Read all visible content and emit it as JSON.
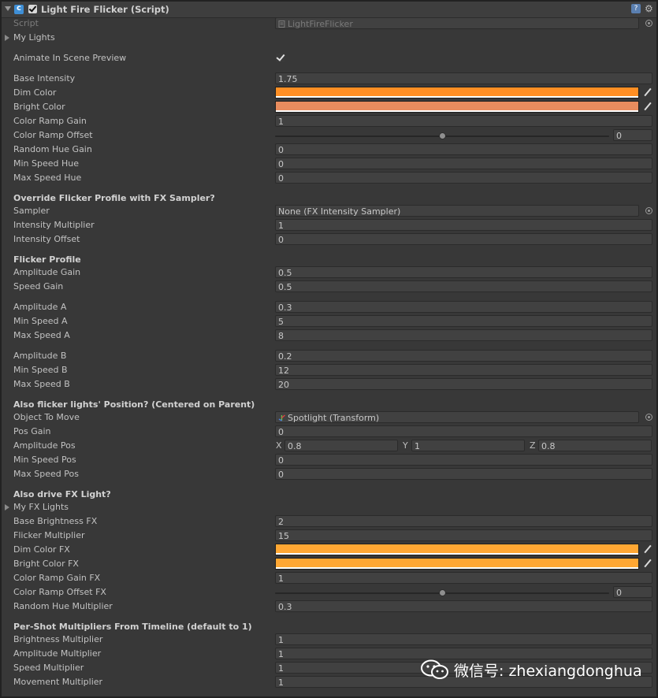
{
  "header": {
    "title": "Light Fire Flicker (Script)",
    "enabled": true
  },
  "script_field": {
    "label": "Script",
    "value": "LightFireFlicker"
  },
  "my_lights": {
    "label": "My Lights"
  },
  "animate_preview": {
    "label": "Animate In Scene Preview",
    "checked": true
  },
  "base": [
    {
      "label": "Base Intensity",
      "value": "1.75"
    }
  ],
  "colors": {
    "dim": {
      "label": "Dim Color",
      "color": "#ff8f24"
    },
    "bright": {
      "label": "Bright Color",
      "color": "#e88c5e"
    }
  },
  "color_ramp_gain": {
    "label": "Color Ramp Gain",
    "value": "1"
  },
  "color_ramp_offset": {
    "label": "Color Ramp Offset",
    "value": "0",
    "slider_fraction": 0.5
  },
  "hue": [
    {
      "label": "Random Hue Gain",
      "value": "0"
    },
    {
      "label": "Min Speed Hue",
      "value": "0"
    },
    {
      "label": "Max Speed Hue",
      "value": "0"
    }
  ],
  "override": {
    "heading": "Override Flicker Profile with FX Sampler?",
    "sampler": {
      "label": "Sampler",
      "value": "None (FX Intensity Sampler)"
    },
    "fields": [
      {
        "label": "Intensity Multiplier",
        "value": "1"
      },
      {
        "label": "Intensity Offset",
        "value": "0"
      }
    ]
  },
  "flicker": {
    "heading": "Flicker Profile",
    "group1": [
      {
        "label": "Amplitude Gain",
        "value": "0.5"
      },
      {
        "label": "Speed Gain",
        "value": "0.5"
      }
    ],
    "group2": [
      {
        "label": "Amplitude A",
        "value": "0.3"
      },
      {
        "label": "Min Speed A",
        "value": "5"
      },
      {
        "label": "Max Speed A",
        "value": "8"
      }
    ],
    "group3": [
      {
        "label": "Amplitude B",
        "value": "0.2"
      },
      {
        "label": "Min Speed B",
        "value": "12"
      },
      {
        "label": "Max Speed B",
        "value": "20"
      }
    ]
  },
  "position": {
    "heading": "Also flicker lights' Position? (Centered on Parent)",
    "object": {
      "label": "Object To Move",
      "value": "Spotlight (Transform)"
    },
    "pos_gain": {
      "label": "Pos Gain",
      "value": "0"
    },
    "amplitude_pos": {
      "label": "Amplitude Pos",
      "x_label": "X",
      "x": "0.8",
      "y_label": "Y",
      "y": "1",
      "z_label": "Z",
      "z": "0.8"
    },
    "speeds": [
      {
        "label": "Min Speed Pos",
        "value": "0"
      },
      {
        "label": "Max Speed Pos",
        "value": "0"
      }
    ]
  },
  "fx": {
    "heading": "Also drive FX Light?",
    "my_fx_lights": {
      "label": "My FX Lights"
    },
    "fields": [
      {
        "label": "Base Brightness FX",
        "value": "2"
      },
      {
        "label": "Flicker Multiplier",
        "value": "15"
      }
    ],
    "dim": {
      "label": "Dim Color FX",
      "color": "#ffa733"
    },
    "bright": {
      "label": "Bright Color FX",
      "color": "#ffa733"
    },
    "ramp_gain": {
      "label": "Color Ramp Gain FX",
      "value": "1"
    },
    "ramp_offset": {
      "label": "Color Ramp Offset FX",
      "value": "0",
      "slider_fraction": 0.5
    },
    "random_hue": {
      "label": "Random Hue Multiplier",
      "value": "0.3"
    }
  },
  "pershot": {
    "heading": "Per-Shot Multipliers From Timeline (default to 1)",
    "fields": [
      {
        "label": "Brightness Multiplier",
        "value": "1"
      },
      {
        "label": "Amplitude Multiplier",
        "value": "1"
      },
      {
        "label": "Speed Multiplier",
        "value": "1"
      },
      {
        "label": "Movement Multiplier",
        "value": "1"
      }
    ]
  },
  "watermark": {
    "text": "微信号: zhexiangdonghua",
    "icon": "wechat-icon"
  }
}
